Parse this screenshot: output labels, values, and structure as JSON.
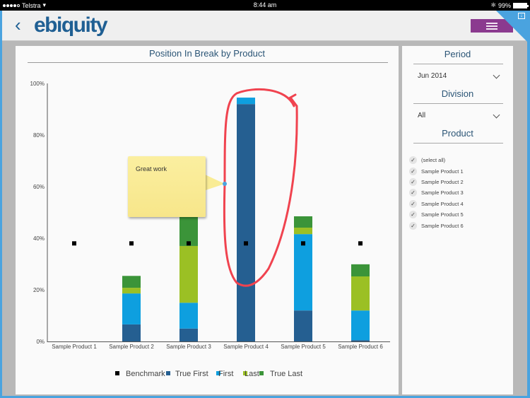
{
  "status_bar": {
    "carrier": "Telstra",
    "time": "8:44 am",
    "battery": "99%"
  },
  "header": {
    "back_label": "‹",
    "logo": "ebiquity",
    "menu_icon": "hamburger-icon",
    "corner_icon": "download-tray-icon"
  },
  "colors": {
    "true_first": "#255f91",
    "first": "#0e9fdf",
    "last": "#9bc024",
    "true_last": "#3b9439",
    "benchmark": "#000000",
    "menu": "#8b3a8f",
    "frame": "#4aa3df",
    "annotation": "#f0434f"
  },
  "chart_data": {
    "type": "bar",
    "stacked": true,
    "title": "Position In Break by Product",
    "xlabel": "",
    "ylabel": "",
    "ylim": [
      0,
      100
    ],
    "yticks": [
      "0%",
      "20%",
      "40%",
      "60%",
      "80%",
      "100%"
    ],
    "ytick_values": [
      0,
      20,
      40,
      60,
      80,
      100
    ],
    "grid": false,
    "legend_position": "bottom",
    "categories": [
      "Sample Product 1",
      "Sample Product 2",
      "Sample Product 3",
      "Sample Product 4",
      "Sample Product 5",
      "Sample Product 6"
    ],
    "series": [
      {
        "name": "True First",
        "color": "#255f91",
        "values": [
          0,
          6.6,
          5.0,
          92.0,
          12.0,
          0.5
        ]
      },
      {
        "name": "First",
        "color": "#0e9fdf",
        "values": [
          0,
          12.0,
          10.0,
          2.5,
          29.6,
          11.5
        ]
      },
      {
        "name": "Last",
        "color": "#9bc024",
        "values": [
          0,
          2.2,
          22.0,
          0,
          2.5,
          13.2
        ]
      },
      {
        "name": "True Last",
        "color": "#3b9439",
        "values": [
          0,
          4.6,
          14.0,
          0,
          4.4,
          4.7
        ]
      }
    ],
    "benchmark": {
      "name": "Benchmark",
      "color": "#000000",
      "values": [
        38,
        38,
        38,
        38,
        38,
        38
      ]
    },
    "legend": [
      "Benchmark",
      "True First",
      "First",
      "Last",
      "True Last"
    ]
  },
  "annotation": {
    "note_text": "Great work",
    "circled_category": "Sample Product 4"
  },
  "filters": {
    "period": {
      "title": "Period",
      "value": "Jun 2014"
    },
    "division": {
      "title": "Division",
      "value": "All"
    },
    "product": {
      "title": "Product",
      "items": [
        {
          "label": "(select all)",
          "checked": true
        },
        {
          "label": "Sample Product 1",
          "checked": true
        },
        {
          "label": "Sample Product 2",
          "checked": true
        },
        {
          "label": "Sample Product 3",
          "checked": true
        },
        {
          "label": "Sample Product 4",
          "checked": true
        },
        {
          "label": "Sample Product 5",
          "checked": true
        },
        {
          "label": "Sample Product 6",
          "checked": true
        }
      ]
    }
  }
}
